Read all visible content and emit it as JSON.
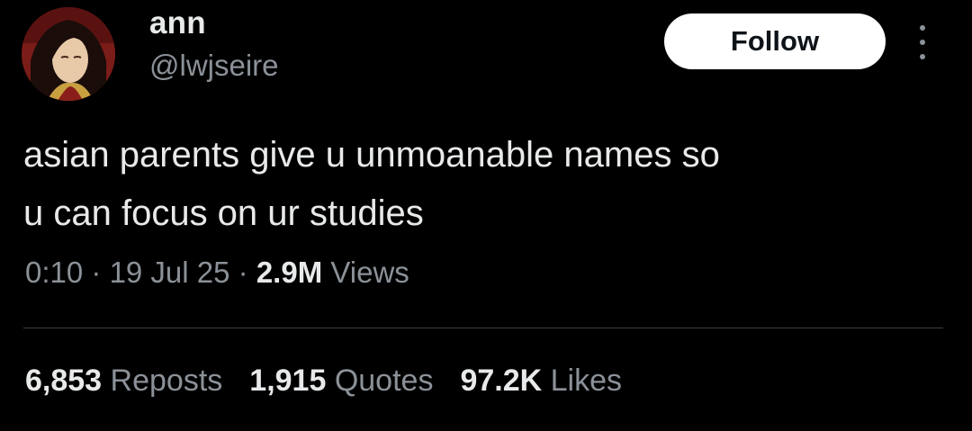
{
  "author": {
    "display_name": "ann",
    "handle": "@lwjseire",
    "avatar_icon": "anime-character-avatar"
  },
  "follow_button": {
    "label": "Follow"
  },
  "more_menu": {
    "icon": "more-vertical-icon"
  },
  "tweet": {
    "text": "asian parents give u unmoanable names so\nu can focus on ur studies",
    "time": "0:10",
    "separator_1": " · ",
    "date": "19 Jul 25",
    "separator_2": " · ",
    "views_count": "2.9M",
    "views_label": " Views"
  },
  "stats": {
    "reposts_count": "6,853",
    "reposts_label": " Reposts",
    "quotes_count": "1,915",
    "quotes_label": " Quotes",
    "likes_count": "97.2K",
    "likes_label": " Likes"
  },
  "colors": {
    "background": "#000000",
    "primary_text": "#e7e9ea",
    "secondary_text": "#8b9198",
    "follow_bg": "#ffffff",
    "divider": "#3a3f44"
  }
}
